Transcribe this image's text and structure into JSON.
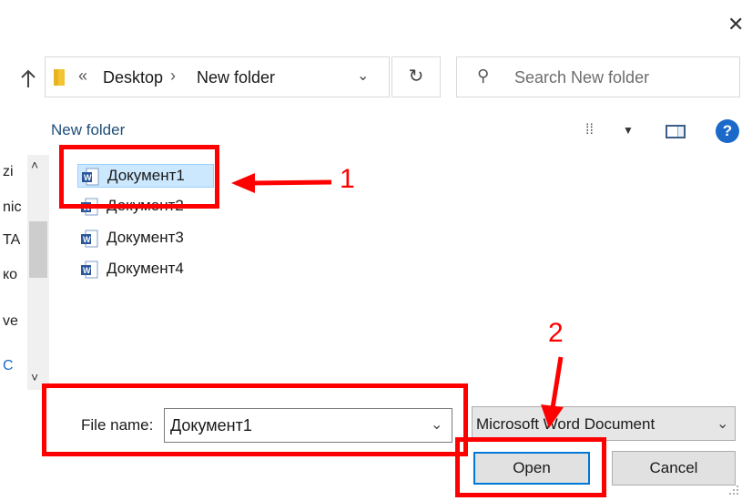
{
  "window": {
    "close_glyph": "✕"
  },
  "address_bar": {
    "crumbs_overflow": "«",
    "crumb_1": "Desktop",
    "separator": "›",
    "crumb_2": "New folder"
  },
  "search": {
    "placeholder": "Search New folder"
  },
  "toolbar": {
    "new_folder_label": "New folder",
    "help_glyph": "?"
  },
  "left_nav_fragments": [
    "zi",
    "nic",
    "TA",
    "ко",
    "ve",
    "C"
  ],
  "files": [
    {
      "name": "Документ1",
      "selected": true
    },
    {
      "name": "Документ2",
      "selected": false
    },
    {
      "name": "Документ3",
      "selected": false
    },
    {
      "name": "Документ4",
      "selected": false
    }
  ],
  "file_name_field": {
    "label": "File name:",
    "value": "Документ1"
  },
  "file_type_select": {
    "value": "Microsoft Word Document"
  },
  "buttons": {
    "open": "Open",
    "cancel": "Cancel"
  },
  "annotations": {
    "step_1": "1",
    "step_2": "2"
  },
  "colors": {
    "annotation": "#ff0000",
    "selection": "#cce8ff",
    "word_blue": "#2b579a"
  }
}
